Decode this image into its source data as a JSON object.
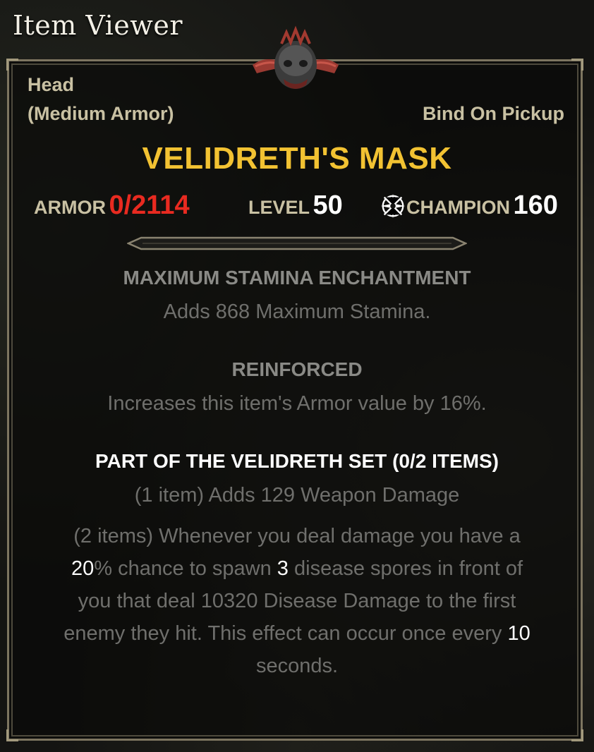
{
  "window_title": "Item Viewer",
  "item": {
    "slot": "Head",
    "armor_type": "(Medium Armor)",
    "bind": "Bind On Pickup",
    "name": "VELIDRETH'S MASK",
    "stats": {
      "armor_label": "ARMOR",
      "armor_value": "0/2114",
      "level_label": "LEVEL",
      "level_value": "50",
      "champion_label": "CHAMPION",
      "champion_value": "160"
    },
    "enchantment": {
      "title": "MAXIMUM STAMINA ENCHANTMENT",
      "description": "Adds 868 Maximum Stamina."
    },
    "trait": {
      "title": "REINFORCED",
      "description": "Increases this item's Armor value by 16%."
    },
    "set": {
      "title": "PART OF THE VELIDRETH SET (0/2 ITEMS)",
      "bonus_1": "(1 item) Adds 129 Weapon Damage",
      "bonus_2": {
        "line1": "(2 items) Whenever you deal damage you have a",
        "line2_hl1": "20",
        "line2_a": "% chance to spawn ",
        "line2_hl2": "3",
        "line2_b": " disease spores in front of",
        "line3": "you that deal 10320 Disease Damage to the first",
        "line4_a": "enemy they hit. This effect can occur once every ",
        "line4_hl": "10",
        "line5": "seconds."
      }
    }
  },
  "colors": {
    "name_gold": "#f2c232",
    "armor_red": "#e82a20",
    "label_tan": "#c9c1a3",
    "border": "#7d7560"
  },
  "icons": {
    "item": "velidreth-mask-icon",
    "champion": "champion-star-icon"
  }
}
